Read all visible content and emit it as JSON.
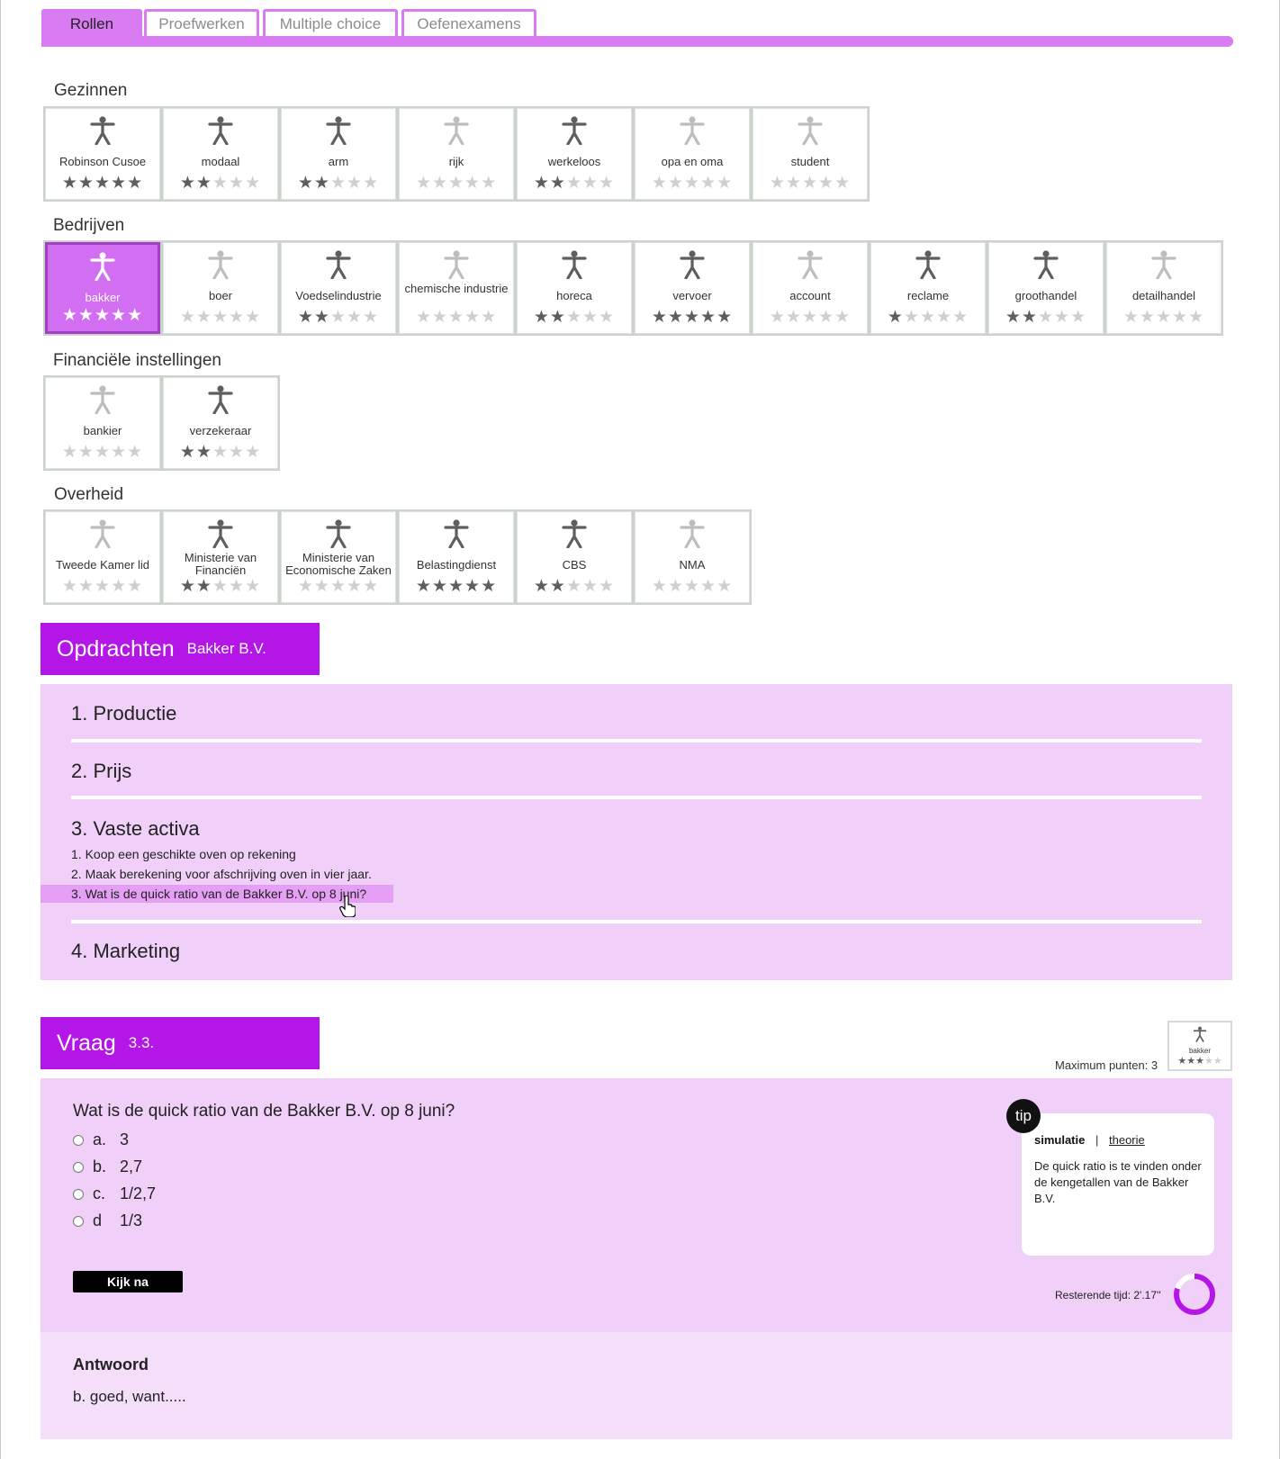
{
  "tabs": [
    {
      "label": "Rollen",
      "active": true
    },
    {
      "label": "Proefwerken",
      "active": false
    },
    {
      "label": "Multiple choice",
      "active": false
    },
    {
      "label": "Oefenexamens",
      "active": false
    }
  ],
  "categories": [
    {
      "title": "Gezinnen",
      "roles": [
        {
          "label": "Robinson Cusoe",
          "stars": 5,
          "active": true
        },
        {
          "label": "modaal",
          "stars": 2,
          "active": true
        },
        {
          "label": "arm",
          "stars": 2,
          "active": true
        },
        {
          "label": "rijk",
          "stars": 0,
          "active": false
        },
        {
          "label": "werkeloos",
          "stars": 2,
          "active": true
        },
        {
          "label": "opa en oma",
          "stars": 0,
          "active": false
        },
        {
          "label": "student",
          "stars": 0,
          "active": false
        }
      ]
    },
    {
      "title": "Bedrijven",
      "roles": [
        {
          "label": "bakker",
          "stars": 5,
          "active": true,
          "selected": true
        },
        {
          "label": "boer",
          "stars": 0,
          "active": false
        },
        {
          "label": "Voedselindustrie",
          "stars": 2,
          "active": true
        },
        {
          "label": "chemische industrie",
          "stars": 0,
          "active": false
        },
        {
          "label": "horeca",
          "stars": 2,
          "active": true
        },
        {
          "label": "vervoer",
          "stars": 5,
          "active": true
        },
        {
          "label": "account",
          "stars": 0,
          "active": false
        },
        {
          "label": "reclame",
          "stars": 1,
          "active": true
        },
        {
          "label": "groothandel",
          "stars": 2,
          "active": true
        },
        {
          "label": "detailhandel",
          "stars": 0,
          "active": false
        }
      ]
    },
    {
      "title": "Financiële instellingen",
      "roles": [
        {
          "label": "bankier",
          "stars": 0,
          "active": false
        },
        {
          "label": "verzekeraar",
          "stars": 2,
          "active": true
        }
      ]
    },
    {
      "title": "Overheid",
      "roles": [
        {
          "label": "Tweede Kamer lid",
          "stars": 0,
          "active": false
        },
        {
          "label": "Ministerie van Financiën",
          "stars": 2,
          "active": true
        },
        {
          "label": "Ministerie van Economische Zaken",
          "stars": 0,
          "active": true
        },
        {
          "label": "Belastingdienst",
          "stars": 5,
          "active": true
        },
        {
          "label": "CBS",
          "stars": 2,
          "active": true
        },
        {
          "label": "NMA",
          "stars": 0,
          "active": false
        }
      ]
    }
  ],
  "assignments": {
    "header": "Opdrachten",
    "subheader": "Bakker B.V.",
    "items": [
      {
        "label": "1. Productie"
      },
      {
        "label": "2. Prijs"
      },
      {
        "label": "3. Vaste activa",
        "subitems": [
          "1. Koop een geschikte oven op rekening",
          "2. Maak berekening voor afschrijving oven in vier jaar.",
          "3. Wat is de quick ratio van de Bakker B.V. op 8 juni?"
        ]
      },
      {
        "label": "4. Marketing"
      }
    ]
  },
  "question": {
    "header": "Vraag",
    "number": "3.3.",
    "max_points": "Maximum punten: 3",
    "mini_role": {
      "label": "bakker",
      "stars": 3
    },
    "text": "Wat is de quick ratio van de Bakker B.V. op 8 juni?",
    "options": [
      {
        "letter": "a.",
        "value": "3"
      },
      {
        "letter": "b.",
        "value": "2,7"
      },
      {
        "letter": "c.",
        "value": "1/2,7"
      },
      {
        "letter": "d",
        "value": "1/3"
      }
    ],
    "check_button": "Kijk na",
    "tip": {
      "badge": "tip",
      "tab_active": "simulatie",
      "separator": "|",
      "tab_link": "theorie",
      "text": "De quick ratio is te vinden onder de kengetallen van de Bakker B.V."
    },
    "timer_label": "Resterende tijd: 2'.17''",
    "timer_fraction_remaining": 0.8
  },
  "answer": {
    "title": "Antwoord",
    "text": "b. goed, want....."
  },
  "colors": {
    "accent": "#b516e8",
    "tab": "#d97cf2",
    "panel": "#f0d0f8",
    "star_on": "#5e5e5e",
    "star_off": "#cfcfcf"
  }
}
